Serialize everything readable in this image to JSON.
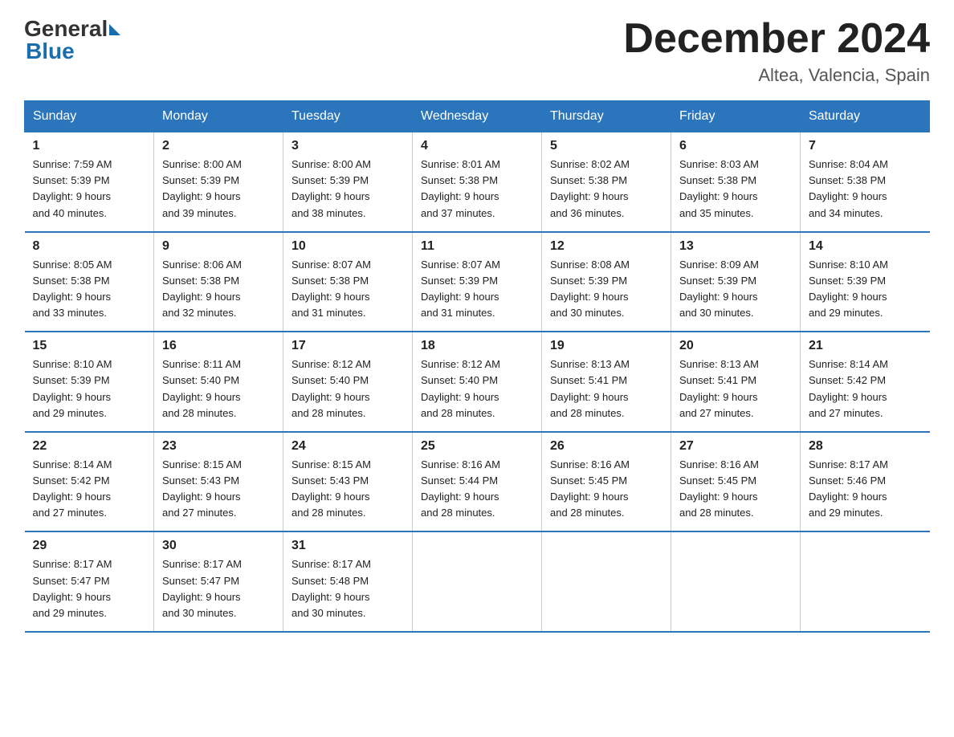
{
  "header": {
    "logo_general": "General",
    "logo_blue": "Blue",
    "title": "December 2024",
    "location": "Altea, Valencia, Spain"
  },
  "days_of_week": [
    "Sunday",
    "Monday",
    "Tuesday",
    "Wednesday",
    "Thursday",
    "Friday",
    "Saturday"
  ],
  "weeks": [
    [
      {
        "day": "1",
        "sunrise": "7:59 AM",
        "sunset": "5:39 PM",
        "daylight": "9 hours and 40 minutes."
      },
      {
        "day": "2",
        "sunrise": "8:00 AM",
        "sunset": "5:39 PM",
        "daylight": "9 hours and 39 minutes."
      },
      {
        "day": "3",
        "sunrise": "8:00 AM",
        "sunset": "5:39 PM",
        "daylight": "9 hours and 38 minutes."
      },
      {
        "day": "4",
        "sunrise": "8:01 AM",
        "sunset": "5:38 PM",
        "daylight": "9 hours and 37 minutes."
      },
      {
        "day": "5",
        "sunrise": "8:02 AM",
        "sunset": "5:38 PM",
        "daylight": "9 hours and 36 minutes."
      },
      {
        "day": "6",
        "sunrise": "8:03 AM",
        "sunset": "5:38 PM",
        "daylight": "9 hours and 35 minutes."
      },
      {
        "day": "7",
        "sunrise": "8:04 AM",
        "sunset": "5:38 PM",
        "daylight": "9 hours and 34 minutes."
      }
    ],
    [
      {
        "day": "8",
        "sunrise": "8:05 AM",
        "sunset": "5:38 PM",
        "daylight": "9 hours and 33 minutes."
      },
      {
        "day": "9",
        "sunrise": "8:06 AM",
        "sunset": "5:38 PM",
        "daylight": "9 hours and 32 minutes."
      },
      {
        "day": "10",
        "sunrise": "8:07 AM",
        "sunset": "5:38 PM",
        "daylight": "9 hours and 31 minutes."
      },
      {
        "day": "11",
        "sunrise": "8:07 AM",
        "sunset": "5:39 PM",
        "daylight": "9 hours and 31 minutes."
      },
      {
        "day": "12",
        "sunrise": "8:08 AM",
        "sunset": "5:39 PM",
        "daylight": "9 hours and 30 minutes."
      },
      {
        "day": "13",
        "sunrise": "8:09 AM",
        "sunset": "5:39 PM",
        "daylight": "9 hours and 30 minutes."
      },
      {
        "day": "14",
        "sunrise": "8:10 AM",
        "sunset": "5:39 PM",
        "daylight": "9 hours and 29 minutes."
      }
    ],
    [
      {
        "day": "15",
        "sunrise": "8:10 AM",
        "sunset": "5:39 PM",
        "daylight": "9 hours and 29 minutes."
      },
      {
        "day": "16",
        "sunrise": "8:11 AM",
        "sunset": "5:40 PM",
        "daylight": "9 hours and 28 minutes."
      },
      {
        "day": "17",
        "sunrise": "8:12 AM",
        "sunset": "5:40 PM",
        "daylight": "9 hours and 28 minutes."
      },
      {
        "day": "18",
        "sunrise": "8:12 AM",
        "sunset": "5:40 PM",
        "daylight": "9 hours and 28 minutes."
      },
      {
        "day": "19",
        "sunrise": "8:13 AM",
        "sunset": "5:41 PM",
        "daylight": "9 hours and 28 minutes."
      },
      {
        "day": "20",
        "sunrise": "8:13 AM",
        "sunset": "5:41 PM",
        "daylight": "9 hours and 27 minutes."
      },
      {
        "day": "21",
        "sunrise": "8:14 AM",
        "sunset": "5:42 PM",
        "daylight": "9 hours and 27 minutes."
      }
    ],
    [
      {
        "day": "22",
        "sunrise": "8:14 AM",
        "sunset": "5:42 PM",
        "daylight": "9 hours and 27 minutes."
      },
      {
        "day": "23",
        "sunrise": "8:15 AM",
        "sunset": "5:43 PM",
        "daylight": "9 hours and 27 minutes."
      },
      {
        "day": "24",
        "sunrise": "8:15 AM",
        "sunset": "5:43 PM",
        "daylight": "9 hours and 28 minutes."
      },
      {
        "day": "25",
        "sunrise": "8:16 AM",
        "sunset": "5:44 PM",
        "daylight": "9 hours and 28 minutes."
      },
      {
        "day": "26",
        "sunrise": "8:16 AM",
        "sunset": "5:45 PM",
        "daylight": "9 hours and 28 minutes."
      },
      {
        "day": "27",
        "sunrise": "8:16 AM",
        "sunset": "5:45 PM",
        "daylight": "9 hours and 28 minutes."
      },
      {
        "day": "28",
        "sunrise": "8:17 AM",
        "sunset": "5:46 PM",
        "daylight": "9 hours and 29 minutes."
      }
    ],
    [
      {
        "day": "29",
        "sunrise": "8:17 AM",
        "sunset": "5:47 PM",
        "daylight": "9 hours and 29 minutes."
      },
      {
        "day": "30",
        "sunrise": "8:17 AM",
        "sunset": "5:47 PM",
        "daylight": "9 hours and 30 minutes."
      },
      {
        "day": "31",
        "sunrise": "8:17 AM",
        "sunset": "5:48 PM",
        "daylight": "9 hours and 30 minutes."
      },
      null,
      null,
      null,
      null
    ]
  ],
  "labels": {
    "sunrise": "Sunrise:",
    "sunset": "Sunset:",
    "daylight": "Daylight:"
  }
}
